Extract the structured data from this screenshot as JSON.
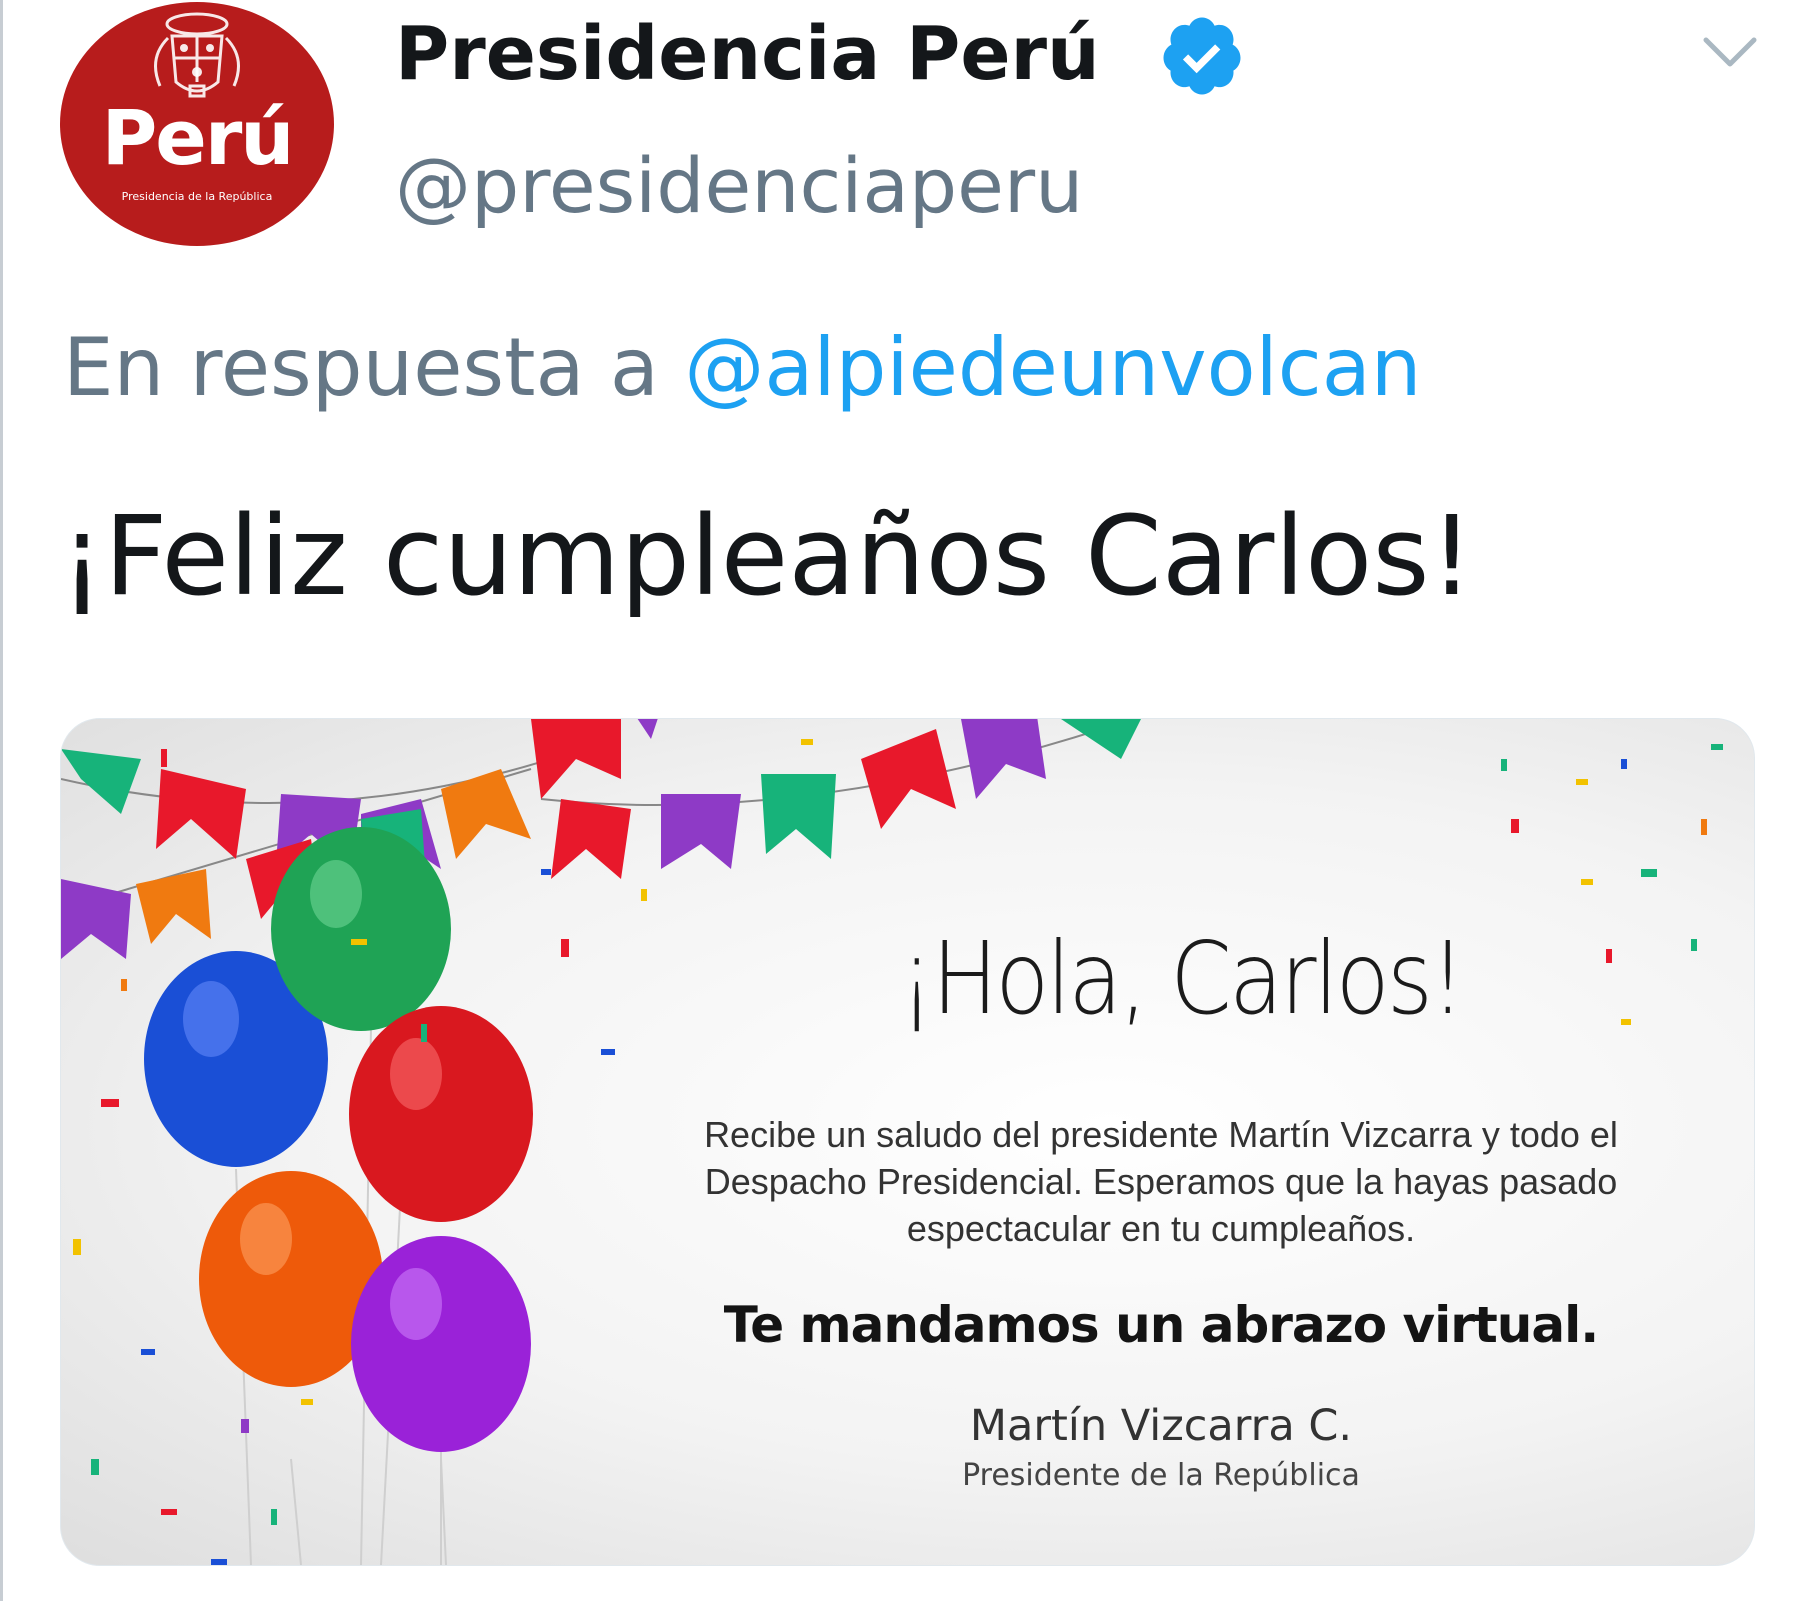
{
  "tweet": {
    "avatar": {
      "word": "Perú",
      "subtitle": "Presidencia de la República",
      "color": "#b71c1c"
    },
    "display_name": "Presidencia Perú",
    "handle": "@presidenciaperu",
    "verified": true,
    "reply_prefix": "En respuesta a ",
    "reply_mention": "@alpiedeunvolcan",
    "text": "¡Feliz cumpleaños Carlos!",
    "colors": {
      "link": "#1da1f2",
      "secondary_text": "#657786",
      "primary_text": "#14171a"
    }
  },
  "media_card": {
    "greeting": "¡Hola, Carlos!",
    "body_lines": [
      "Recibe un saludo del presidente Martín Vizcarra y todo el",
      "Despacho Presidencial. Esperamos que la hayas pasado",
      "espectacular en tu cumpleaños."
    ],
    "hug": "Te mandamos un abrazo virtual.",
    "signature": "Martín Vizcarra C.",
    "role": "Presidente de la República"
  },
  "icons": {
    "verified": "verified-badge-icon",
    "menu": "chevron-down-icon"
  }
}
